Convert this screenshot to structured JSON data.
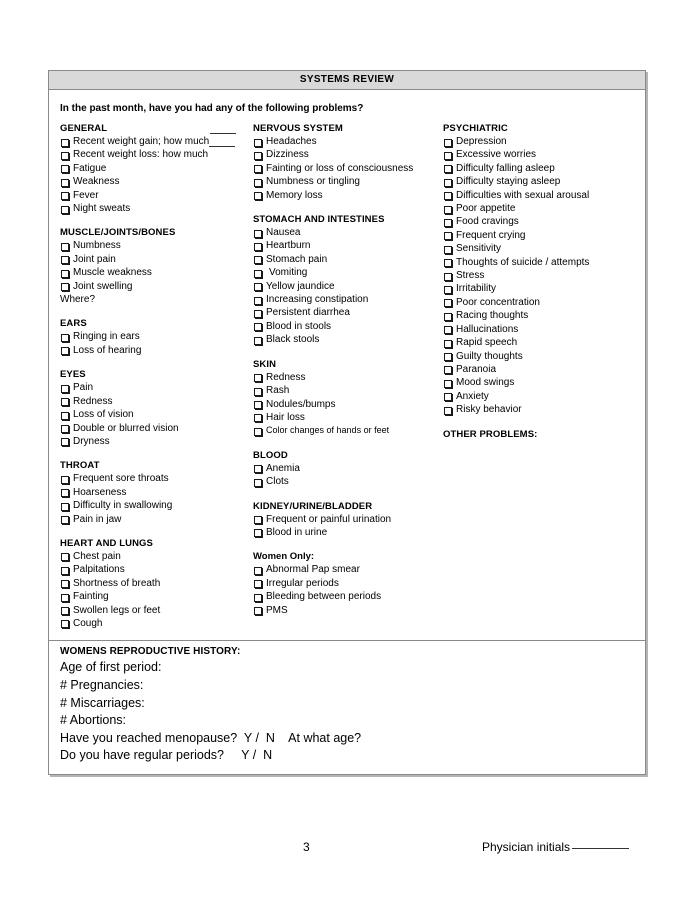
{
  "form": {
    "title": "SYSTEMS REVIEW",
    "prompt": "In the past month, have you had any of the following problems?",
    "columns": [
      {
        "sections": [
          {
            "heading": "GENERAL",
            "items": [
              {
                "label": "Recent weight gain; how much",
                "blank": true
              },
              {
                "label": "Recent weight loss: how much",
                "blank": true
              },
              {
                "label": "Fatigue"
              },
              {
                "label": "Weakness"
              },
              {
                "label": "Fever"
              },
              {
                "label": "Night sweats"
              }
            ]
          },
          {
            "heading": "MUSCLE/JOINTS/BONES",
            "items": [
              {
                "label": "Numbness"
              },
              {
                "label": "Joint pain"
              },
              {
                "label": "Muscle weakness"
              },
              {
                "label": "Joint swelling"
              },
              {
                "label": "Where?",
                "checkbox": false
              }
            ]
          },
          {
            "heading": "EARS",
            "items": [
              {
                "label": "Ringing in ears"
              },
              {
                "label": "Loss of hearing"
              }
            ]
          },
          {
            "heading": "EYES",
            "items": [
              {
                "label": "Pain"
              },
              {
                "label": "Redness"
              },
              {
                "label": "Loss of vision"
              },
              {
                "label": "Double or blurred vision"
              },
              {
                "label": "Dryness"
              }
            ]
          },
          {
            "heading": "THROAT",
            "items": [
              {
                "label": "Frequent sore throats"
              },
              {
                "label": "Hoarseness"
              },
              {
                "label": "Difficulty in swallowing"
              },
              {
                "label": "Pain in jaw"
              }
            ]
          },
          {
            "heading": "HEART AND LUNGS",
            "items": [
              {
                "label": "Chest pain"
              },
              {
                "label": "Palpitations"
              },
              {
                "label": "Shortness of breath"
              },
              {
                "label": "Fainting"
              },
              {
                "label": "Swollen legs or feet"
              },
              {
                "label": "Cough"
              }
            ]
          }
        ]
      },
      {
        "sections": [
          {
            "heading": "NERVOUS SYSTEM",
            "items": [
              {
                "label": "Headaches"
              },
              {
                "label": "Dizziness"
              },
              {
                "label": "Fainting or loss of consciousness"
              },
              {
                "label": "Numbness or tingling"
              },
              {
                "label": "Memory loss"
              }
            ]
          },
          {
            "heading": "STOMACH AND INTESTINES",
            "items": [
              {
                "label": "Nausea"
              },
              {
                "label": "Heartburn"
              },
              {
                "label": "Stomach pain"
              },
              {
                "label": "Vomiting",
                "indent": true
              },
              {
                "label": "Yellow jaundice"
              },
              {
                "label": "Increasing constipation"
              },
              {
                "label": "Persistent diarrhea"
              },
              {
                "label": "Blood in stools"
              },
              {
                "label": "Black stools"
              }
            ]
          },
          {
            "heading": "SKIN",
            "items": [
              {
                "label": "Redness"
              },
              {
                "label": "Rash"
              },
              {
                "label": "Nodules/bumps"
              },
              {
                "label": "Hair loss"
              },
              {
                "label": "Color changes of hands or feet",
                "small": true
              }
            ]
          },
          {
            "heading": "BLOOD",
            "items": [
              {
                "label": "Anemia"
              },
              {
                "label": "Clots"
              }
            ]
          },
          {
            "heading": "KIDNEY/URINE/BLADDER",
            "items": [
              {
                "label": "Frequent or painful urination"
              },
              {
                "label": "Blood in urine"
              }
            ]
          },
          {
            "heading": "Women Only:",
            "mixed_case": true,
            "items": [
              {
                "label": "Abnormal Pap smear"
              },
              {
                "label": "Irregular periods"
              },
              {
                "label": "Bleeding between periods"
              },
              {
                "label": "PMS"
              }
            ]
          }
        ]
      },
      {
        "sections": [
          {
            "heading": "PSYCHIATRIC",
            "items": [
              {
                "label": "Depression"
              },
              {
                "label": "Excessive worries"
              },
              {
                "label": "Difficulty falling asleep"
              },
              {
                "label": "Difficulty staying asleep"
              },
              {
                "label": "Difficulties with sexual arousal"
              },
              {
                "label": "Poor appetite"
              },
              {
                "label": "Food cravings"
              },
              {
                "label": "Frequent crying"
              },
              {
                "label": "Sensitivity"
              },
              {
                "label": "Thoughts of suicide / attempts"
              },
              {
                "label": "Stress"
              },
              {
                "label": "Irritability"
              },
              {
                "label": "Poor concentration"
              },
              {
                "label": "Racing thoughts"
              },
              {
                "label": "Hallucinations"
              },
              {
                "label": "Rapid speech"
              },
              {
                "label": "Guilty thoughts"
              },
              {
                "label": "Paranoia"
              },
              {
                "label": "Mood swings"
              },
              {
                "label": "Anxiety"
              },
              {
                "label": "Risky behavior"
              }
            ]
          },
          {
            "heading": "OTHER PROBLEMS:",
            "items": []
          }
        ]
      }
    ],
    "reproductive_history": {
      "heading": "WOMENS REPRODUCTIVE HISTORY:",
      "lines": [
        "Age of first period:",
        "# Pregnancies:",
        "# Miscarriages:",
        "# Abortions:",
        "Have you reached menopause?  Y /  N    At what age?",
        "Do you have regular periods?     Y /  N"
      ]
    }
  },
  "footer": {
    "page_number": "3",
    "initials_label": "Physician initials"
  }
}
